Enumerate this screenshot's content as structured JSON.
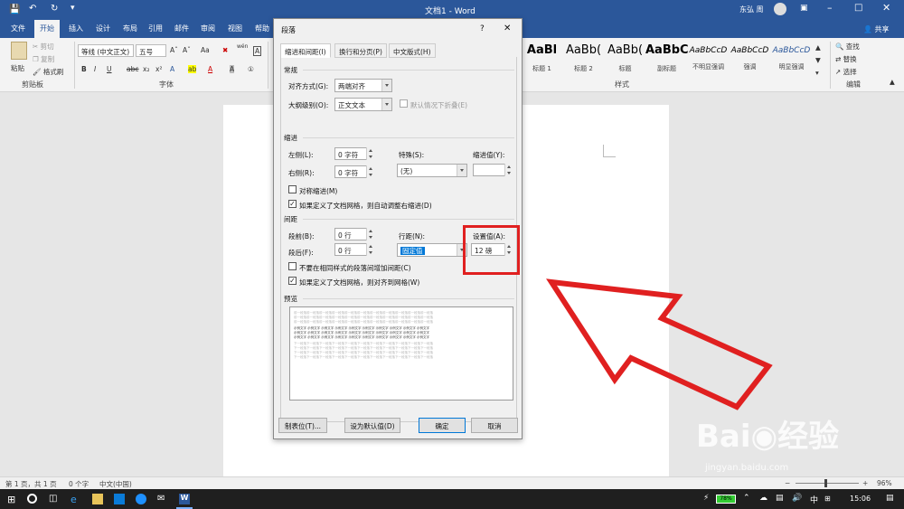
{
  "window": {
    "title": "文档1 - Word",
    "user": "东弘 周",
    "share": "共享"
  },
  "tabs": [
    "文件",
    "开始",
    "插入",
    "设计",
    "布局",
    "引用",
    "邮件",
    "审阅",
    "视图",
    "帮助"
  ],
  "ribbon": {
    "clipboard": {
      "paste": "粘贴",
      "cut": "剪切",
      "copy": "复制",
      "format_painter": "格式刷",
      "group": "剪贴板"
    },
    "font": {
      "name": "等线 (中文正文)",
      "size": "五号",
      "aa": "Aa",
      "wen": "wén",
      "A": "A",
      "group": "字体"
    },
    "styles": {
      "items": [
        {
          "preview": "AaBl",
          "name": "标题 1"
        },
        {
          "preview": "AaBb(",
          "name": "标题 2"
        },
        {
          "preview": "AaBb(",
          "name": "标题"
        },
        {
          "preview": "AaBbC",
          "name": "副标题"
        },
        {
          "preview": "AaBbCcD",
          "name": "不明显强调"
        },
        {
          "preview": "AaBbCcD",
          "name": "强调"
        },
        {
          "preview": "AaBbCcD",
          "name": "明显强调"
        }
      ],
      "group": "样式"
    },
    "editing": {
      "find": "查找",
      "replace": "替换",
      "select": "选择",
      "group": "编辑"
    }
  },
  "dialog": {
    "title": "段落",
    "help": "?",
    "tabs": [
      "缩进和间距(I)",
      "换行和分页(P)",
      "中文版式(H)"
    ],
    "general": {
      "section": "常规",
      "align_label": "对齐方式(G):",
      "align_value": "两端对齐",
      "outline_label": "大纲级别(O):",
      "outline_value": "正文文本",
      "collapse_label": "默认情况下折叠(E)"
    },
    "indent": {
      "section": "缩进",
      "left_label": "左侧(L):",
      "left_value": "0 字符",
      "right_label": "右侧(R):",
      "right_value": "0 字符",
      "special_label": "特殊(S):",
      "special_value": "(无)",
      "by_label": "缩进值(Y):",
      "by_value": "",
      "mirror_label": "对称缩进(M)",
      "grid_label": "如果定义了文档网格，则自动调整右缩进(D)"
    },
    "spacing": {
      "section": "间距",
      "before_label": "段前(B):",
      "before_value": "0 行",
      "after_label": "段后(F):",
      "after_value": "0 行",
      "line_label": "行距(N):",
      "line_value": "固定值",
      "at_label": "设置值(A):",
      "at_value": "12 磅",
      "no_space_label": "不要在相同样式的段落间增加间距(C)",
      "snap_label": "如果定义了文档网格，则对齐到网格(W)"
    },
    "preview": {
      "section": "预览",
      "prev_text": "前一段落前一段落前一段落前一段落前一段落前一段落前一段落前一段落前一段落前一段落前一段落",
      "sample_text": "示例文字 示例文字 示例文字 示例文字 示例文字 示例文字 示例文字 示例文字 示例文字 示例文字",
      "next_text": "下一段落下一段落下一段落下一段落下一段落下一段落下一段落下一段落下一段落下一段落下一段落"
    },
    "buttons": {
      "tabs": "制表位(T)...",
      "default": "设为默认值(D)",
      "ok": "确定",
      "cancel": "取消"
    }
  },
  "status": {
    "page": "第 1 页，共 1 页",
    "words": "0 个字",
    "lang": "中文(中国)",
    "zoom": "96%"
  },
  "taskbar": {
    "battery": "78%",
    "ime": "中",
    "time": "15:06"
  },
  "colors": {
    "word_blue": "#2b579a",
    "highlight_red": "#e02020",
    "selection_blue": "#0078d7"
  }
}
